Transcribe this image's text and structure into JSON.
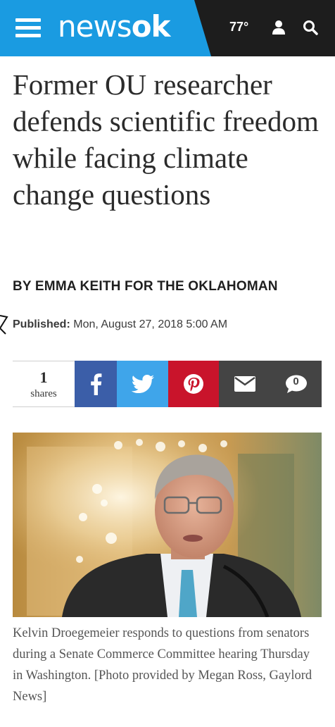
{
  "header": {
    "logo_news": "news",
    "logo_ok": "ok",
    "temperature": "77°",
    "colors": {
      "brand_blue": "#1a9be1",
      "dark": "#1d1d1d"
    },
    "icons": [
      "hamburger-menu-icon",
      "user-icon",
      "search-icon"
    ]
  },
  "article": {
    "headline": "Former OU researcher defends scientific freedom while facing climate change questions",
    "byline": "BY EMMA KEITH FOR THE OKLAHOMAN",
    "published_label": "Published:",
    "published_date": "Mon, August 27, 2018 5:00 AM"
  },
  "share": {
    "count": "1",
    "count_label": "shares",
    "comment_count": "0",
    "buttons": [
      {
        "name": "facebook",
        "icon": "facebook-icon",
        "color": "#3b5ea8"
      },
      {
        "name": "twitter",
        "icon": "twitter-icon",
        "color": "#3fa5ea"
      },
      {
        "name": "pinterest",
        "icon": "pinterest-icon",
        "color": "#c9142b"
      },
      {
        "name": "email",
        "icon": "email-icon",
        "color": "#444444"
      },
      {
        "name": "comments",
        "icon": "comment-icon",
        "color": "#444444"
      }
    ]
  },
  "photo": {
    "caption": "Kelvin Droegemeier responds to questions from senators during a Senate Commerce Committee hearing Thursday in Washington. [Photo provided by Megan Ross, Gaylord News]"
  }
}
